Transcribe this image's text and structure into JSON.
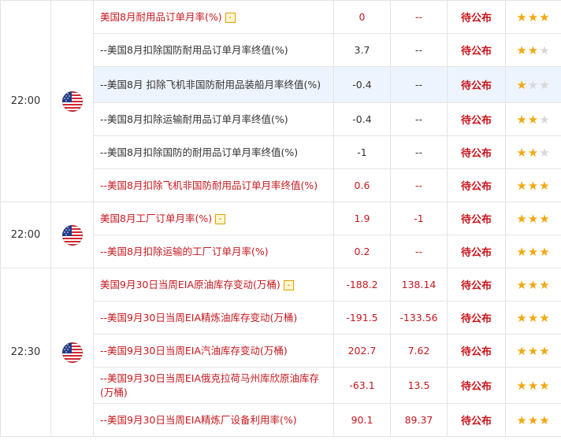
{
  "groups": [
    {
      "time": "22:00",
      "rows": [
        {
          "name": "美国8月耐用品订单月率(%)",
          "expand": true,
          "red": true,
          "prev": "0",
          "forecast": "--",
          "status": "待公布",
          "stars": 3
        },
        {
          "name": "--美国8月扣除国防耐用品订单月率终值(%)",
          "expand": false,
          "red": false,
          "prev": "3.7",
          "forecast": "--",
          "status": "待公布",
          "stars": 2
        },
        {
          "name": "--美国8月 扣除飞机非国防耐用品装船月率终值(%)",
          "expand": false,
          "red": false,
          "prev": "-0.4",
          "forecast": "--",
          "status": "待公布",
          "stars": 1
        },
        {
          "name": "--美国8月扣除运输耐用品订单月率终值(%)",
          "expand": false,
          "red": false,
          "prev": "-0.4",
          "forecast": "--",
          "status": "待公布",
          "stars": 2
        },
        {
          "name": "--美国8月扣除国防的耐用品订单月率终值(%)",
          "expand": false,
          "red": false,
          "prev": "-1",
          "forecast": "--",
          "status": "待公布",
          "stars": 2
        },
        {
          "name": "--美国8月扣除飞机非国防耐用品订单月率终值(%)",
          "expand": false,
          "red": true,
          "prev": "0.6",
          "forecast": "--",
          "status": "待公布",
          "stars": 3
        }
      ]
    },
    {
      "time": "22:00",
      "rows": [
        {
          "name": "美国8月工厂订单月率(%)",
          "expand": true,
          "red": true,
          "prev": "1.9",
          "forecast": "-1",
          "status": "待公布",
          "stars": 3
        },
        {
          "name": "--美国8月扣除运输的工厂订单月率(%)",
          "expand": false,
          "red": true,
          "prev": "0.2",
          "forecast": "--",
          "status": "待公布",
          "stars": 3
        }
      ]
    },
    {
      "time": "22:30",
      "rows": [
        {
          "name": "美国9月30日当周EIA原油库存变动(万桶)",
          "expand": true,
          "red": true,
          "prev": "-188.2",
          "forecast": "138.14",
          "status": "待公布",
          "stars": 3
        },
        {
          "name": "--美国9月30日当周EIA精炼油库存变动(万桶)",
          "expand": false,
          "red": true,
          "prev": "-191.5",
          "forecast": "-133.56",
          "status": "待公布",
          "stars": 3
        },
        {
          "name": "--美国9月30日当周EIA汽油库存变动(万桶)",
          "expand": false,
          "red": true,
          "prev": "202.7",
          "forecast": "7.62",
          "status": "待公布",
          "stars": 3
        },
        {
          "name": "--美国9月30日当周EIA俄克拉荷马州库欣原油库存(万桶)",
          "expand": false,
          "red": true,
          "prev": "-63.1",
          "forecast": "13.5",
          "status": "待公布",
          "stars": 3
        },
        {
          "name": "--美国9月30日当周EIA精炼厂设备利用率(%)",
          "expand": false,
          "red": true,
          "prev": "90.1",
          "forecast": "89.37",
          "status": "待公布",
          "stars": 3
        }
      ]
    }
  ],
  "flag": "us-flag-icon",
  "expand_label": "-",
  "colors": {
    "highlight": "#c4191f",
    "status": "#c8141a",
    "star": "#f0a812"
  }
}
